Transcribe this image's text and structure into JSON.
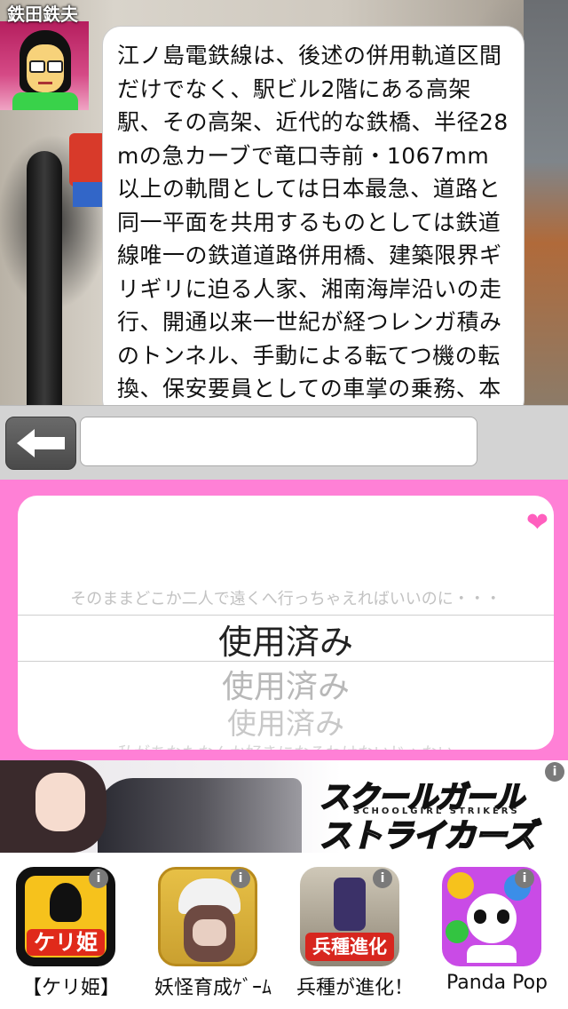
{
  "chat": {
    "speaker_name": "鉄田鉄夫",
    "message": "江ノ島電鉄線は、後述の併用軌道区間だけでなく、駅ビル2階にある高架駅、その高架、近代的な鉄橋、半径28mの急カーブで竜口寺前・1067mm以上の軌間としては日本最急、道路と同一平面を共用するものとしては鉄道線唯一の鉄道道路併用橋、建築限界ギリギリに迫る人家、湘南海岸沿いの走行、開通以来一世紀が経つレンガ積みのトンネル、手動による転てつ機の転換、保安要員としての車掌の乗務、本線上での増解結作"
  },
  "input_bar": {
    "back_icon": "left-arrow-icon",
    "text_value": ""
  },
  "picker": {
    "heart_icon": "heart-icon",
    "rows": [
      "そのままどこか二人で遠くへ行っちゃえればいいのに・・・",
      "使用済み",
      "使用済み",
      "使用済み",
      "私があなたなんか好きになるわけないじゃない"
    ],
    "selected_index": 1
  },
  "banner_ad": {
    "title_line1": "スクールガール",
    "subtitle": "SCHOOLGIRL STRIKERS",
    "title_line2": "ストライカーズ",
    "info_glyph": "i"
  },
  "app_promos": [
    {
      "label": "【ケリ姫】",
      "icon_text": "ケリ姫",
      "info_glyph": "i"
    },
    {
      "label": "妖怪育成ｹﾞｰﾑ",
      "icon_text": "",
      "info_glyph": "i"
    },
    {
      "label": "兵種が進化！",
      "icon_text": "兵種進化",
      "info_glyph": "i"
    },
    {
      "label": "Panda Pop",
      "icon_text": "",
      "info_glyph": "i"
    }
  ],
  "colors": {
    "picker_frame": "#ff80d6",
    "heart": "#ff5fbe",
    "avatar_shirt": "#39d24a"
  }
}
